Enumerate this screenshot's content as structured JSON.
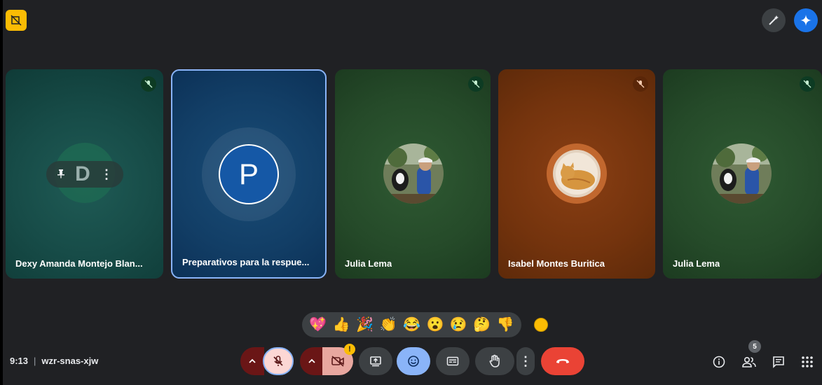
{
  "meeting": {
    "time": "9:13",
    "separator": "|",
    "code": "wzr-snas-xjw"
  },
  "tiles": [
    {
      "name": "Dexy Amanda Montejo Blan...",
      "avatar_letter": "D",
      "color": "#174c48"
    },
    {
      "name": "Preparativos para la respue...",
      "avatar_letter": "P",
      "color": "#123e66"
    },
    {
      "name": "Julia Lema",
      "color": "#254a29"
    },
    {
      "name": "Isabel Montes Buritica",
      "color": "#73330d"
    },
    {
      "name": "Julia Lema",
      "color": "#254a29"
    }
  ],
  "reactions": [
    "💖",
    "👍",
    "🎉",
    "👏",
    "😂",
    "😮",
    "😢",
    "🤔",
    "👎"
  ],
  "controls": {
    "camera_warning": "!",
    "people_count": "5"
  },
  "colors": {
    "accent": "#8ab4f8",
    "leave": "#ea4335",
    "brand": "#fbbc04"
  }
}
